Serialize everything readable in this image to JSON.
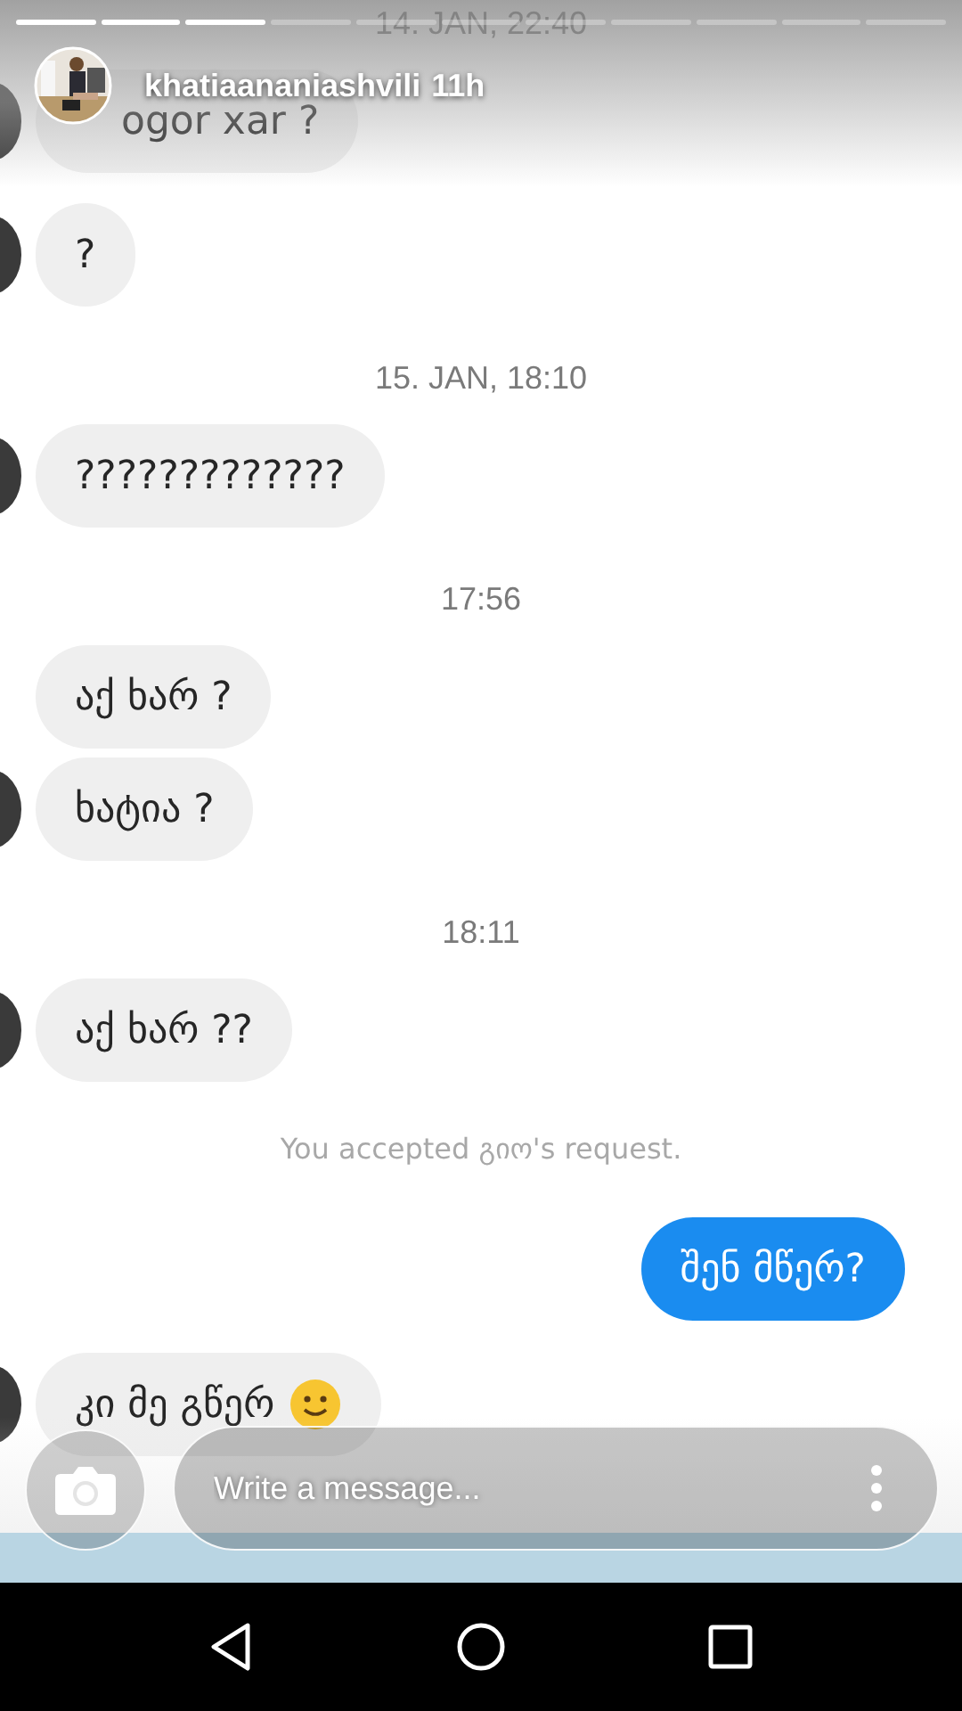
{
  "story_progress": [
    {
      "viewed": true
    },
    {
      "viewed": true
    },
    {
      "viewed": true
    },
    {
      "viewed": false
    },
    {
      "viewed": false
    },
    {
      "viewed": false
    },
    {
      "viewed": false
    },
    {
      "viewed": false
    },
    {
      "viewed": false
    },
    {
      "viewed": false
    },
    {
      "viewed": false
    }
  ],
  "story_header": {
    "username": "khatiaananiashvili",
    "age": "11h"
  },
  "messages": [
    {
      "kind": "date",
      "text": "14. JAN, 22:40"
    },
    {
      "kind": "in",
      "text": "ogor xar ?",
      "avatar": true
    },
    {
      "kind": "in",
      "text": "?",
      "avatar": true
    },
    {
      "kind": "date",
      "text": "15. JAN, 18:10"
    },
    {
      "kind": "in",
      "text": "?????????????",
      "avatar": true
    },
    {
      "kind": "date",
      "text": "17:56"
    },
    {
      "kind": "in",
      "text": "აქ ხარ ?",
      "avatar": false
    },
    {
      "kind": "in",
      "text": "ხატია ?",
      "avatar": true
    },
    {
      "kind": "date",
      "text": "18:11"
    },
    {
      "kind": "in",
      "text": "აქ ხარ ??",
      "avatar": true
    },
    {
      "kind": "notice",
      "text": "You accepted გიო's request."
    },
    {
      "kind": "out",
      "text": "შენ მწერ?"
    },
    {
      "kind": "in",
      "text": "კი მე გწერ",
      "avatar": true,
      "smiley": true
    }
  ],
  "reply_bar": {
    "placeholder": "Write a message..."
  }
}
